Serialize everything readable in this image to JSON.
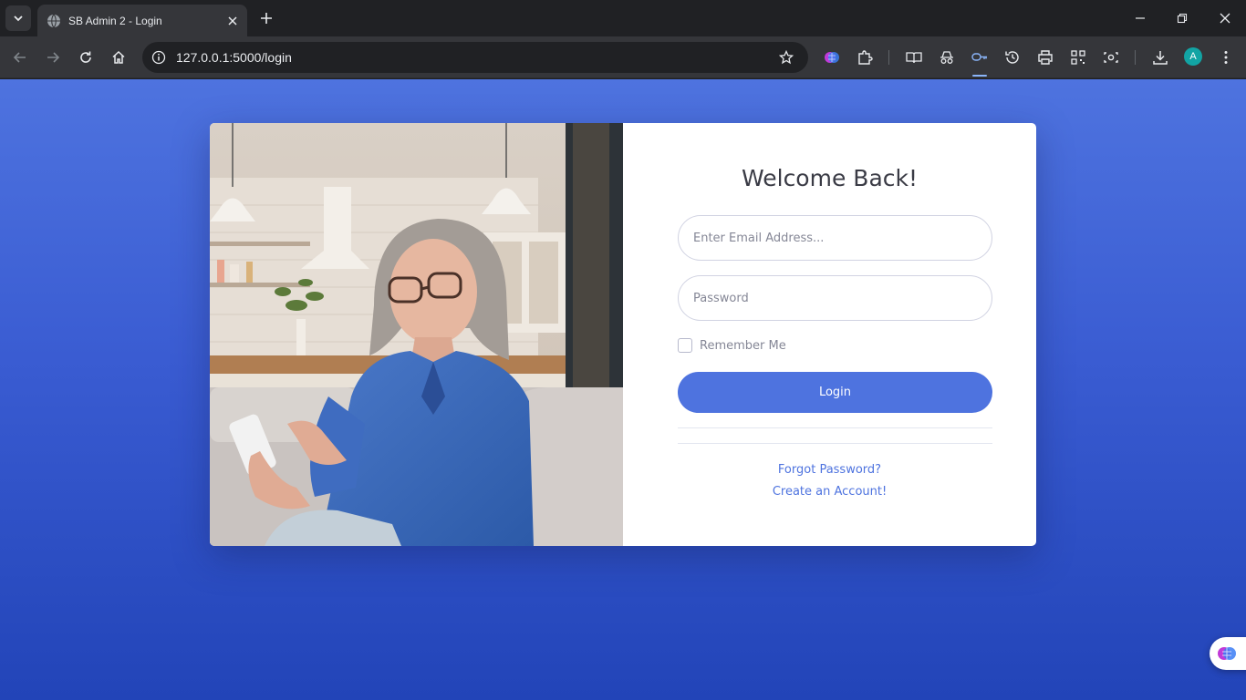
{
  "browser": {
    "tab_title": "SB Admin 2 - Login",
    "url": "127.0.0.1:5000/login",
    "profile_initial": "A"
  },
  "login": {
    "heading": "Welcome Back!",
    "email_placeholder": "Enter Email Address...",
    "password_placeholder": "Password",
    "remember_label": "Remember Me",
    "login_label": "Login",
    "forgot_link": "Forgot Password?",
    "create_link": "Create an Account!"
  },
  "colors": {
    "primary": "#4e73df",
    "background_top": "#4e73df",
    "background_bottom": "#2244b8"
  }
}
